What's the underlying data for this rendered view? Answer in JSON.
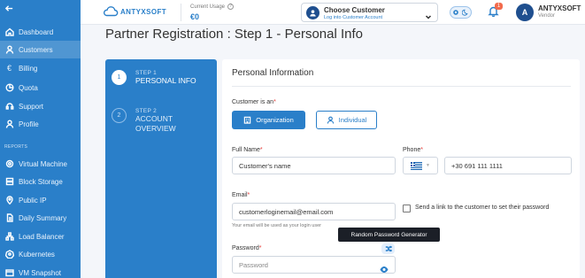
{
  "sidebar": {
    "items": [
      {
        "label": "Dashboard",
        "icon": "home-icon"
      },
      {
        "label": "Customers",
        "icon": "user-icon"
      },
      {
        "label": "Billing",
        "icon": "euro-icon"
      },
      {
        "label": "Quota",
        "icon": "pie-chart-icon"
      },
      {
        "label": "Support",
        "icon": "support-icon"
      },
      {
        "label": "Profile",
        "icon": "profile-icon"
      }
    ],
    "section_label": "REPORTS",
    "report_items": [
      {
        "label": "Virtual Machine",
        "icon": "vm-icon"
      },
      {
        "label": "Block Storage",
        "icon": "storage-icon"
      },
      {
        "label": "Public IP",
        "icon": "location-icon"
      },
      {
        "label": "Daily Summary",
        "icon": "document-icon"
      },
      {
        "label": "Load Balancer",
        "icon": "network-icon"
      },
      {
        "label": "Kubernetes",
        "icon": "kubernetes-icon"
      },
      {
        "label": "VM Snapshot",
        "icon": "snapshot-icon"
      }
    ],
    "active_item": "Customers"
  },
  "topbar": {
    "logo_text": "ANTYXSOFT",
    "usage_label": "Current Usage",
    "usage_value": "€0",
    "customer_select": {
      "title": "Choose Customer",
      "subtitle": "Log into Customer Account"
    },
    "notification_count": "1",
    "user": {
      "initial": "A",
      "name": "ANTYXSOFT",
      "role": "Vendor"
    }
  },
  "page": {
    "title": "Partner Registration : Step 1 - Personal Info"
  },
  "steps": [
    {
      "number": "1",
      "label": "STEP 1",
      "title_lines": [
        "PERSONAL INFO"
      ],
      "active": true
    },
    {
      "number": "2",
      "label": "STEP 2",
      "title_lines": [
        "ACCOUNT",
        "OVERVIEW"
      ],
      "active": false
    }
  ],
  "form": {
    "section_title": "Personal Information",
    "customer_is_label": "Customer is an",
    "organization_button": "Organization",
    "individual_button": "Individual",
    "full_name_label": "Full Name",
    "full_name_value": "Customer's name",
    "phone_label": "Phone",
    "phone_value": "+30 691 111 1111",
    "phone_country": "Greece",
    "email_label": "Email",
    "email_value": "customerloginemail@email.com",
    "email_hint": "Your email will be used as your login user",
    "send_link_label": "Send a link to the customer to set their password",
    "password_label": "Password",
    "password_placeholder": "Password",
    "tooltip": "Random Password Generator"
  },
  "colors": {
    "primary": "#2a7fc9",
    "sidebar": "#2a7fc9",
    "avatar": "#1f4f8f",
    "badge": "#f26b4d",
    "required": "#e53935"
  }
}
